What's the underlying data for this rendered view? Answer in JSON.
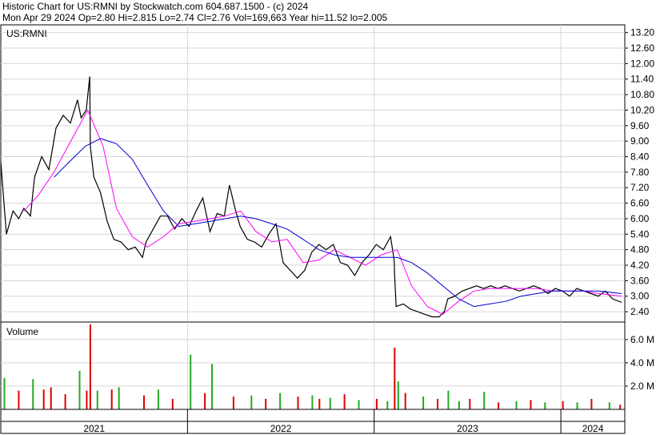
{
  "header": {
    "line1": "Historic Chart for US:RMNI by Stockwatch.com 604.687.1500 - (c) 2024",
    "line2": "Mon Apr 29 2024  Op=2.80  Hi=2.815  Lo=2.74  Cl=2.76  Vol=169,663  Year hi=11.52  lo=2.005"
  },
  "chart_data": [
    {
      "type": "line",
      "symbol_label": "US:RMNI",
      "y_ticks": [
        "13.20",
        "12.60",
        "12.00",
        "11.40",
        "10.80",
        "10.20",
        "9.60",
        "9.00",
        "8.40",
        "7.80",
        "7.20",
        "6.60",
        "6.00",
        "5.40",
        "4.80",
        "4.20",
        "3.60",
        "3.00",
        "2.40"
      ],
      "ylim": [
        2.0,
        13.5
      ],
      "x_ticks": [
        "2021",
        "2022",
        "2023",
        "2024"
      ],
      "series": [
        {
          "color": "#000000",
          "points": [
            [
              "2021-01-01",
              8.2
            ],
            [
              "2021-01-12",
              5.4
            ],
            [
              "2021-01-25",
              6.3
            ],
            [
              "2021-02-05",
              6.0
            ],
            [
              "2021-02-15",
              6.4
            ],
            [
              "2021-02-28",
              6.1
            ],
            [
              "2021-03-08",
              7.6
            ],
            [
              "2021-03-22",
              8.4
            ],
            [
              "2021-04-05",
              7.9
            ],
            [
              "2021-04-19",
              9.5
            ],
            [
              "2021-05-03",
              10.0
            ],
            [
              "2021-05-17",
              9.7
            ],
            [
              "2021-05-31",
              10.6
            ],
            [
              "2021-06-07",
              9.9
            ],
            [
              "2021-06-17",
              10.2
            ],
            [
              "2021-06-24",
              11.5
            ],
            [
              "2021-06-25",
              8.8
            ],
            [
              "2021-07-02",
              7.6
            ],
            [
              "2021-07-15",
              7.0
            ],
            [
              "2021-07-28",
              5.9
            ],
            [
              "2021-08-10",
              5.2
            ],
            [
              "2021-08-24",
              5.1
            ],
            [
              "2021-09-07",
              4.8
            ],
            [
              "2021-09-21",
              4.9
            ],
            [
              "2021-10-05",
              4.5
            ],
            [
              "2021-10-12",
              5.1
            ],
            [
              "2021-10-26",
              5.6
            ],
            [
              "2021-11-09",
              6.1
            ],
            [
              "2021-11-23",
              6.1
            ],
            [
              "2021-12-07",
              5.6
            ],
            [
              "2021-12-21",
              6.0
            ],
            [
              "2022-01-04",
              5.7
            ],
            [
              "2022-01-18",
              6.3
            ],
            [
              "2022-01-31",
              6.8
            ],
            [
              "2022-02-14",
              5.5
            ],
            [
              "2022-02-28",
              6.2
            ],
            [
              "2022-03-14",
              6.1
            ],
            [
              "2022-03-24",
              7.3
            ],
            [
              "2022-04-04",
              6.4
            ],
            [
              "2022-04-14",
              5.7
            ],
            [
              "2022-04-28",
              5.2
            ],
            [
              "2022-05-12",
              5.1
            ],
            [
              "2022-05-26",
              4.9
            ],
            [
              "2022-06-09",
              5.4
            ],
            [
              "2022-06-23",
              5.8
            ],
            [
              "2022-07-07",
              4.3
            ],
            [
              "2022-07-21",
              4.0
            ],
            [
              "2022-08-04",
              3.7
            ],
            [
              "2022-08-18",
              4.0
            ],
            [
              "2022-09-01",
              4.7
            ],
            [
              "2022-09-15",
              5.0
            ],
            [
              "2022-09-29",
              4.8
            ],
            [
              "2022-10-13",
              5.0
            ],
            [
              "2022-10-27",
              4.3
            ],
            [
              "2022-11-10",
              4.2
            ],
            [
              "2022-11-24",
              3.8
            ],
            [
              "2022-12-08",
              4.3
            ],
            [
              "2022-12-22",
              4.6
            ],
            [
              "2023-01-05",
              5.0
            ],
            [
              "2023-01-19",
              4.8
            ],
            [
              "2023-02-02",
              5.3
            ],
            [
              "2023-02-09",
              4.4
            ],
            [
              "2023-02-10",
              3.8
            ],
            [
              "2023-02-13",
              2.6
            ],
            [
              "2023-02-27",
              2.7
            ],
            [
              "2023-03-13",
              2.5
            ],
            [
              "2023-03-27",
              2.4
            ],
            [
              "2023-04-10",
              2.3
            ],
            [
              "2023-04-24",
              2.2
            ],
            [
              "2023-05-08",
              2.2
            ],
            [
              "2023-05-18",
              2.4
            ],
            [
              "2023-05-25",
              2.9
            ],
            [
              "2023-06-08",
              3.0
            ],
            [
              "2023-06-22",
              3.2
            ],
            [
              "2023-07-06",
              3.3
            ],
            [
              "2023-07-20",
              3.4
            ],
            [
              "2023-08-03",
              3.3
            ],
            [
              "2023-08-17",
              3.4
            ],
            [
              "2023-08-31",
              3.3
            ],
            [
              "2023-09-14",
              3.4
            ],
            [
              "2023-09-28",
              3.3
            ],
            [
              "2023-10-12",
              3.2
            ],
            [
              "2023-10-26",
              3.3
            ],
            [
              "2023-11-09",
              3.4
            ],
            [
              "2023-11-23",
              3.3
            ],
            [
              "2023-12-07",
              3.1
            ],
            [
              "2023-12-21",
              3.3
            ],
            [
              "2024-01-04",
              3.2
            ],
            [
              "2024-01-18",
              3.0
            ],
            [
              "2024-02-01",
              3.3
            ],
            [
              "2024-02-15",
              3.2
            ],
            [
              "2024-02-29",
              3.1
            ],
            [
              "2024-03-14",
              3.0
            ],
            [
              "2024-03-28",
              3.2
            ],
            [
              "2024-04-11",
              2.9
            ],
            [
              "2024-04-29",
              2.76
            ]
          ]
        },
        {
          "color": "#ff00ff",
          "points": [
            [
              "2021-02-15",
              6.3
            ],
            [
              "2021-03-15",
              6.9
            ],
            [
              "2021-04-15",
              7.8
            ],
            [
              "2021-05-15",
              8.9
            ],
            [
              "2021-06-20",
              10.2
            ],
            [
              "2021-07-20",
              8.8
            ],
            [
              "2021-08-15",
              6.4
            ],
            [
              "2021-09-15",
              5.3
            ],
            [
              "2021-10-15",
              4.9
            ],
            [
              "2021-11-15",
              5.3
            ],
            [
              "2021-12-15",
              5.8
            ],
            [
              "2022-01-15",
              5.9
            ],
            [
              "2022-02-15",
              6.0
            ],
            [
              "2022-03-15",
              6.1
            ],
            [
              "2022-04-15",
              6.3
            ],
            [
              "2022-05-15",
              5.5
            ],
            [
              "2022-06-15",
              5.1
            ],
            [
              "2022-07-15",
              5.2
            ],
            [
              "2022-08-15",
              4.3
            ],
            [
              "2022-09-15",
              4.4
            ],
            [
              "2022-10-15",
              4.8
            ],
            [
              "2022-11-15",
              4.5
            ],
            [
              "2022-12-15",
              4.2
            ],
            [
              "2023-01-15",
              4.6
            ],
            [
              "2023-02-15",
              4.8
            ],
            [
              "2023-03-15",
              3.4
            ],
            [
              "2023-04-15",
              2.6
            ],
            [
              "2023-05-15",
              2.3
            ],
            [
              "2023-06-15",
              2.8
            ],
            [
              "2023-07-15",
              3.2
            ],
            [
              "2023-08-15",
              3.3
            ],
            [
              "2023-09-15",
              3.3
            ],
            [
              "2023-10-15",
              3.3
            ],
            [
              "2023-11-15",
              3.3
            ],
            [
              "2023-12-15",
              3.2
            ],
            [
              "2024-01-15",
              3.2
            ],
            [
              "2024-02-15",
              3.2
            ],
            [
              "2024-03-15",
              3.1
            ],
            [
              "2024-04-29",
              3.0
            ]
          ]
        },
        {
          "color": "#0000cc",
          "points": [
            [
              "2021-04-15",
              7.6
            ],
            [
              "2021-05-15",
              8.2
            ],
            [
              "2021-06-15",
              8.8
            ],
            [
              "2021-07-15",
              9.1
            ],
            [
              "2021-08-15",
              8.9
            ],
            [
              "2021-09-15",
              8.3
            ],
            [
              "2021-10-15",
              7.3
            ],
            [
              "2021-11-15",
              6.3
            ],
            [
              "2021-12-15",
              5.7
            ],
            [
              "2022-01-15",
              5.8
            ],
            [
              "2022-02-15",
              5.9
            ],
            [
              "2022-03-15",
              6.0
            ],
            [
              "2022-04-15",
              6.1
            ],
            [
              "2022-05-15",
              6.0
            ],
            [
              "2022-06-15",
              5.8
            ],
            [
              "2022-07-15",
              5.6
            ],
            [
              "2022-08-15",
              5.2
            ],
            [
              "2022-09-15",
              4.8
            ],
            [
              "2022-10-15",
              4.6
            ],
            [
              "2022-11-15",
              4.5
            ],
            [
              "2022-12-15",
              4.5
            ],
            [
              "2023-01-15",
              4.5
            ],
            [
              "2023-02-15",
              4.5
            ],
            [
              "2023-03-15",
              4.3
            ],
            [
              "2023-04-15",
              3.9
            ],
            [
              "2023-05-15",
              3.4
            ],
            [
              "2023-06-15",
              2.9
            ],
            [
              "2023-07-15",
              2.6
            ],
            [
              "2023-08-15",
              2.7
            ],
            [
              "2023-09-15",
              2.8
            ],
            [
              "2023-10-15",
              3.0
            ],
            [
              "2023-11-15",
              3.1
            ],
            [
              "2023-12-15",
              3.2
            ],
            [
              "2024-01-15",
              3.2
            ],
            [
              "2024-02-15",
              3.2
            ],
            [
              "2024-03-15",
              3.2
            ],
            [
              "2024-04-29",
              3.1
            ]
          ]
        }
      ]
    },
    {
      "type": "bar",
      "title": "Volume",
      "y_ticks": [
        "6.0 M",
        "4.0 M",
        "2.0 M"
      ],
      "ylim": [
        0,
        7.5
      ],
      "up_color": "#22aa22",
      "down_color": "#dd0000",
      "x": [
        "2021-01-08",
        "2021-02-05",
        "2021-03-05",
        "2021-03-26",
        "2021-04-09",
        "2021-05-07",
        "2021-06-04",
        "2021-06-18",
        "2021-06-25",
        "2021-07-09",
        "2021-08-06",
        "2021-08-20",
        "2021-10-08",
        "2021-11-05",
        "2021-12-03",
        "2022-01-07",
        "2022-02-04",
        "2022-02-18",
        "2022-04-01",
        "2022-05-06",
        "2022-06-03",
        "2022-07-01",
        "2022-08-05",
        "2022-09-02",
        "2022-09-16",
        "2022-10-07",
        "2022-11-04",
        "2022-12-02",
        "2023-01-06",
        "2023-01-27",
        "2023-02-10",
        "2023-02-17",
        "2023-03-03",
        "2023-04-07",
        "2023-05-05",
        "2023-05-26",
        "2023-06-16",
        "2023-07-07",
        "2023-08-04",
        "2023-09-01",
        "2023-10-06",
        "2023-11-03",
        "2023-12-01",
        "2024-01-05",
        "2024-02-02",
        "2024-03-01",
        "2024-04-05",
        "2024-04-26"
      ],
      "values": [
        2.7,
        1.6,
        2.6,
        1.7,
        1.9,
        1.3,
        3.3,
        1.6,
        7.3,
        1.6,
        1.7,
        1.9,
        1.2,
        1.7,
        0.9,
        4.7,
        1.4,
        3.9,
        1.1,
        1.2,
        0.9,
        1.4,
        1.1,
        1.2,
        0.9,
        1.0,
        1.3,
        0.8,
        0.9,
        0.7,
        5.3,
        2.4,
        1.4,
        1.1,
        0.9,
        1.6,
        0.7,
        0.9,
        1.5,
        0.6,
        0.7,
        0.8,
        0.6,
        0.7,
        0.6,
        0.9,
        0.6,
        0.4
      ],
      "direction": [
        "up",
        "down",
        "up",
        "down",
        "down",
        "down",
        "up",
        "down",
        "down",
        "up",
        "down",
        "up",
        "down",
        "up",
        "down",
        "up",
        "down",
        "up",
        "down",
        "up",
        "down",
        "up",
        "down",
        "up",
        "down",
        "up",
        "down",
        "up",
        "down",
        "up",
        "down",
        "up",
        "down",
        "up",
        "down",
        "up",
        "up",
        "down",
        "up",
        "down",
        "up",
        "down",
        "up",
        "down",
        "up",
        "down",
        "up",
        "down"
      ]
    }
  ]
}
